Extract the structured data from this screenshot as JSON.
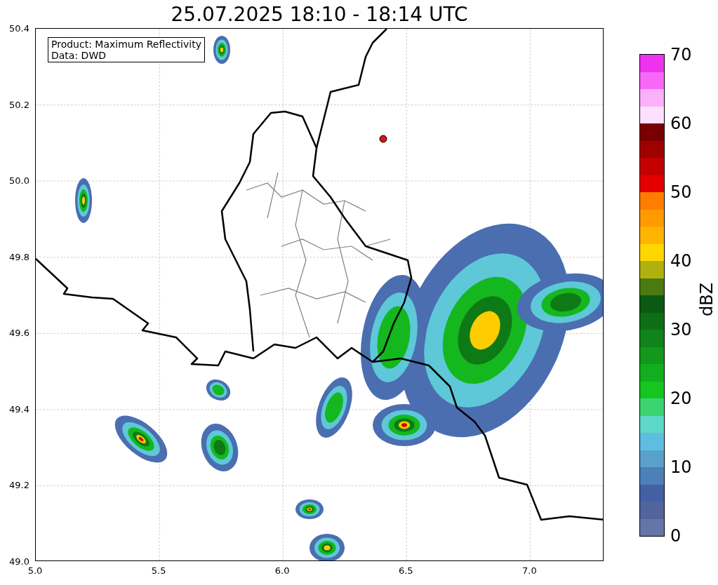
{
  "title": "25.07.2025 18:10 - 18:14 UTC",
  "info_box": [
    "Product: Maximum Reflectivity",
    "Data: DWD"
  ],
  "y_ticks": [
    "50.4",
    "50.2",
    "50.0",
    "49.8",
    "49.6",
    "49.4",
    "49.2",
    "49.0"
  ],
  "x_ticks": [
    "5.0",
    "5.5",
    "6.0",
    "6.5",
    "7.0"
  ],
  "colorbar": {
    "label": "dBZ",
    "ticks": [
      "70",
      "60",
      "50",
      "40",
      "30",
      "20",
      "10",
      "0"
    ],
    "segments": [
      {
        "color": "#ee33ee"
      },
      {
        "color": "#f868f8"
      },
      {
        "color": "#fbb0fb"
      },
      {
        "color": "#fde0fd"
      },
      {
        "color": "#780000"
      },
      {
        "color": "#a00000"
      },
      {
        "color": "#c40000"
      },
      {
        "color": "#e40000"
      },
      {
        "color": "#ff7d00"
      },
      {
        "color": "#ff9a00"
      },
      {
        "color": "#ffb400"
      },
      {
        "color": "#ffd700"
      },
      {
        "color": "#b0b00e"
      },
      {
        "color": "#4a7a10"
      },
      {
        "color": "#0a5a14"
      },
      {
        "color": "#0e6e16"
      },
      {
        "color": "#10841a"
      },
      {
        "color": "#12981c"
      },
      {
        "color": "#12ae1e"
      },
      {
        "color": "#14c61e"
      },
      {
        "color": "#3cd470"
      },
      {
        "color": "#5ed8c8"
      },
      {
        "color": "#5ebee0"
      },
      {
        "color": "#5aa0cc"
      },
      {
        "color": "#4c80b8"
      },
      {
        "color": "#4460a4"
      },
      {
        "color": "#52649c"
      },
      {
        "color": "#6476a8"
      }
    ]
  }
}
